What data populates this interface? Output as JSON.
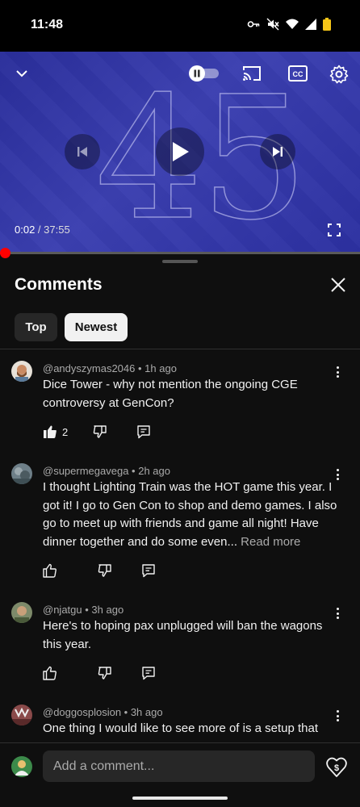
{
  "status_bar": {
    "time": "11:48",
    "icons": [
      "vpn-key-icon",
      "mute-icon",
      "wifi-icon",
      "signal-icon",
      "battery-icon"
    ]
  },
  "player": {
    "current_time": "0:02",
    "separator": " / ",
    "duration": "37:55",
    "progress_fraction": 0.0009,
    "background_digits": [
      "4",
      "5"
    ],
    "controls": [
      "collapse-icon",
      "autoplay-toggle",
      "cast-icon",
      "captions-icon",
      "settings-icon",
      "previous-icon",
      "play-icon",
      "next-icon",
      "fullscreen-icon"
    ]
  },
  "comments_panel": {
    "title": "Comments",
    "chips": [
      {
        "label": "Top",
        "selected": false
      },
      {
        "label": "Newest",
        "selected": true
      }
    ],
    "comments": [
      {
        "author": "@andyszymas2046",
        "age": "1h ago",
        "text": "Dice Tower - why not mention the ongoing CGE controversy at GenCon?",
        "read_more": "",
        "likes": "2",
        "liked": true
      },
      {
        "author": "@supermegavega",
        "age": "2h ago",
        "text": "I thought Lighting Train was the HOT game this year.  I got it!  I go to Gen Con to shop and demo games.  I also go to meet up with friends and game all night! Have dinner together and do some even...",
        "read_more": "Read more",
        "likes": "",
        "liked": false
      },
      {
        "author": "@njatgu",
        "age": "3h ago",
        "text": "Here's to hoping pax unplugged will ban the wagons this year.",
        "read_more": "",
        "likes": "",
        "liked": false
      },
      {
        "author": "@doggosplosion",
        "age": "3h ago",
        "text": "One thing I would like to see more of is a setup that",
        "read_more": "",
        "likes": "",
        "liked": false
      }
    ],
    "meta_separator": " • "
  },
  "composer": {
    "placeholder": "Add a comment..."
  },
  "colors": {
    "background": "#0f0f0f",
    "progress": "#ff0000",
    "chip_selected_bg": "#f1f1f1",
    "chip_bg": "#272727",
    "muted_text": "#aaaaaa"
  }
}
